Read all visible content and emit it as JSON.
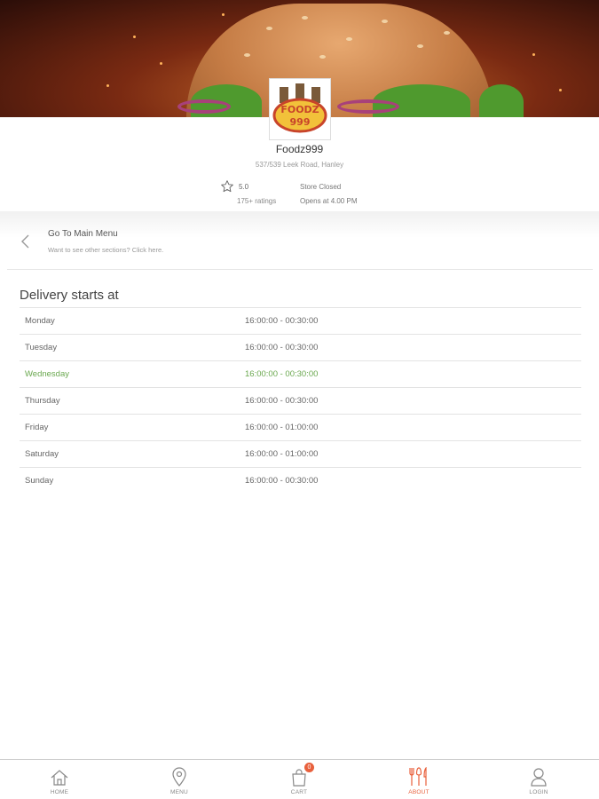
{
  "store": {
    "name": "Foodz999",
    "address": "537/539 Leek Road, Hanley",
    "rating": "5.0",
    "ratings_count": "175+ ratings",
    "status": "Store Closed",
    "opens_at": "Opens at 4.00 PM",
    "logo_text_line1": "FOODZ",
    "logo_text_line2": "999"
  },
  "back_nav": {
    "title": "Go To Main Menu",
    "subtitle": "Want to see other sections? Click here."
  },
  "delivery": {
    "heading": "Delivery starts at",
    "rows": [
      {
        "day": "Monday",
        "time": "16:00:00 - 00:30:00"
      },
      {
        "day": "Tuesday",
        "time": "16:00:00 - 00:30:00"
      },
      {
        "day": "Wednesday",
        "time": "16:00:00 - 00:30:00"
      },
      {
        "day": "Thursday",
        "time": "16:00:00 - 00:30:00"
      },
      {
        "day": "Friday",
        "time": "16:00:00 - 01:00:00"
      },
      {
        "day": "Saturday",
        "time": "16:00:00 - 01:00:00"
      },
      {
        "day": "Sunday",
        "time": "16:00:00 - 00:30:00"
      }
    ],
    "highlight_color": "#6aa84f"
  },
  "tabs": [
    {
      "label": "HOME",
      "icon": "home-icon"
    },
    {
      "label": "MENU",
      "icon": "location-pin-icon"
    },
    {
      "label": "CART",
      "icon": "shopping-bag-icon",
      "badge": "0"
    },
    {
      "label": "ABOUT",
      "icon": "cutlery-icon",
      "active": true
    },
    {
      "label": "LOGIN",
      "icon": "user-icon"
    }
  ],
  "colors": {
    "accent": "#e8603c"
  }
}
